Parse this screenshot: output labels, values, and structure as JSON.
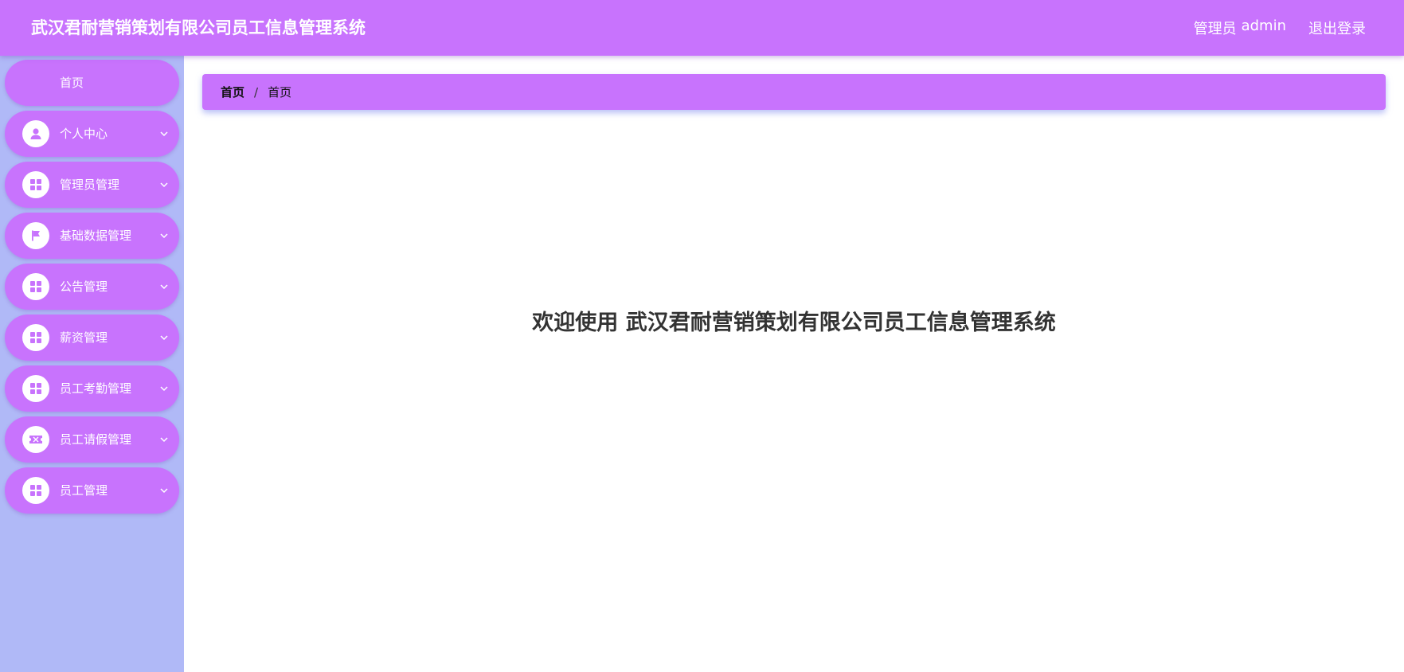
{
  "header": {
    "title": "武汉君耐营销策划有限公司员工信息管理系统",
    "role_label": "管理员",
    "username": "admin",
    "logout_label": "退出登录"
  },
  "sidebar": {
    "items": [
      {
        "label": "首页",
        "icon": "none",
        "has_submenu": false
      },
      {
        "label": "个人中心",
        "icon": "user-icon",
        "has_submenu": true
      },
      {
        "label": "管理员管理",
        "icon": "grid-icon",
        "has_submenu": true
      },
      {
        "label": "基础数据管理",
        "icon": "flag-icon",
        "has_submenu": true
      },
      {
        "label": "公告管理",
        "icon": "grid-icon",
        "has_submenu": true
      },
      {
        "label": "薪资管理",
        "icon": "grid-icon",
        "has_submenu": true
      },
      {
        "label": "员工考勤管理",
        "icon": "grid-icon",
        "has_submenu": true
      },
      {
        "label": "员工请假管理",
        "icon": "ticket-icon",
        "has_submenu": true
      },
      {
        "label": "员工管理",
        "icon": "grid-icon",
        "has_submenu": true
      }
    ]
  },
  "breadcrumb": {
    "first": "首页",
    "separator": "/",
    "current": "首页"
  },
  "main": {
    "welcome_text": "欢迎使用 武汉君耐营销策划有限公司员工信息管理系统"
  },
  "colors": {
    "accent": "#c873fd",
    "sidebar_bg": "#b0b9f7",
    "text_dark": "#333333"
  }
}
